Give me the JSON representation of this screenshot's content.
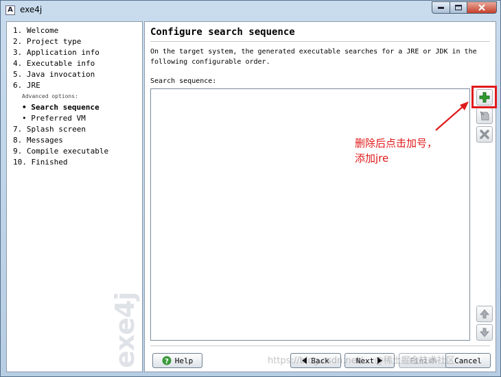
{
  "window": {
    "title": "exe4j"
  },
  "nav": {
    "steps": [
      "1. Welcome",
      "2. Project type",
      "3. Application info",
      "4. Executable info",
      "5. Java invocation",
      "6. JRE"
    ],
    "advanced_label": "Advanced options:",
    "sub_items": [
      "• Search sequence",
      "• Preferred VM"
    ],
    "steps_after": [
      "7. Splash screen",
      "8. Messages",
      "9. Compile executable",
      "10. Finished"
    ],
    "logo": "exe4j"
  },
  "content": {
    "title": "Configure search sequence",
    "description": "On the target system, the generated executable searches for a JRE or JDK in the following configurable order.",
    "sequence_label": "Search sequence:"
  },
  "annotation": {
    "line1": "删除后点击加号，",
    "line2": "添加jre"
  },
  "buttons": {
    "help": "Help",
    "back": "Back",
    "next": "Next",
    "finish": "Finish",
    "cancel": "Cancel"
  },
  "icons": {
    "add": "plus-icon",
    "edit": "edit-icon",
    "remove": "remove-icon",
    "up": "arrow-up-icon",
    "down": "arrow-down-icon",
    "help": "help-icon"
  },
  "colors": {
    "annotation": "#e0191a",
    "add_icon": "#2e9e2e"
  },
  "watermark": "https://blog.csdn.net/... @稀土掘金技术社区"
}
